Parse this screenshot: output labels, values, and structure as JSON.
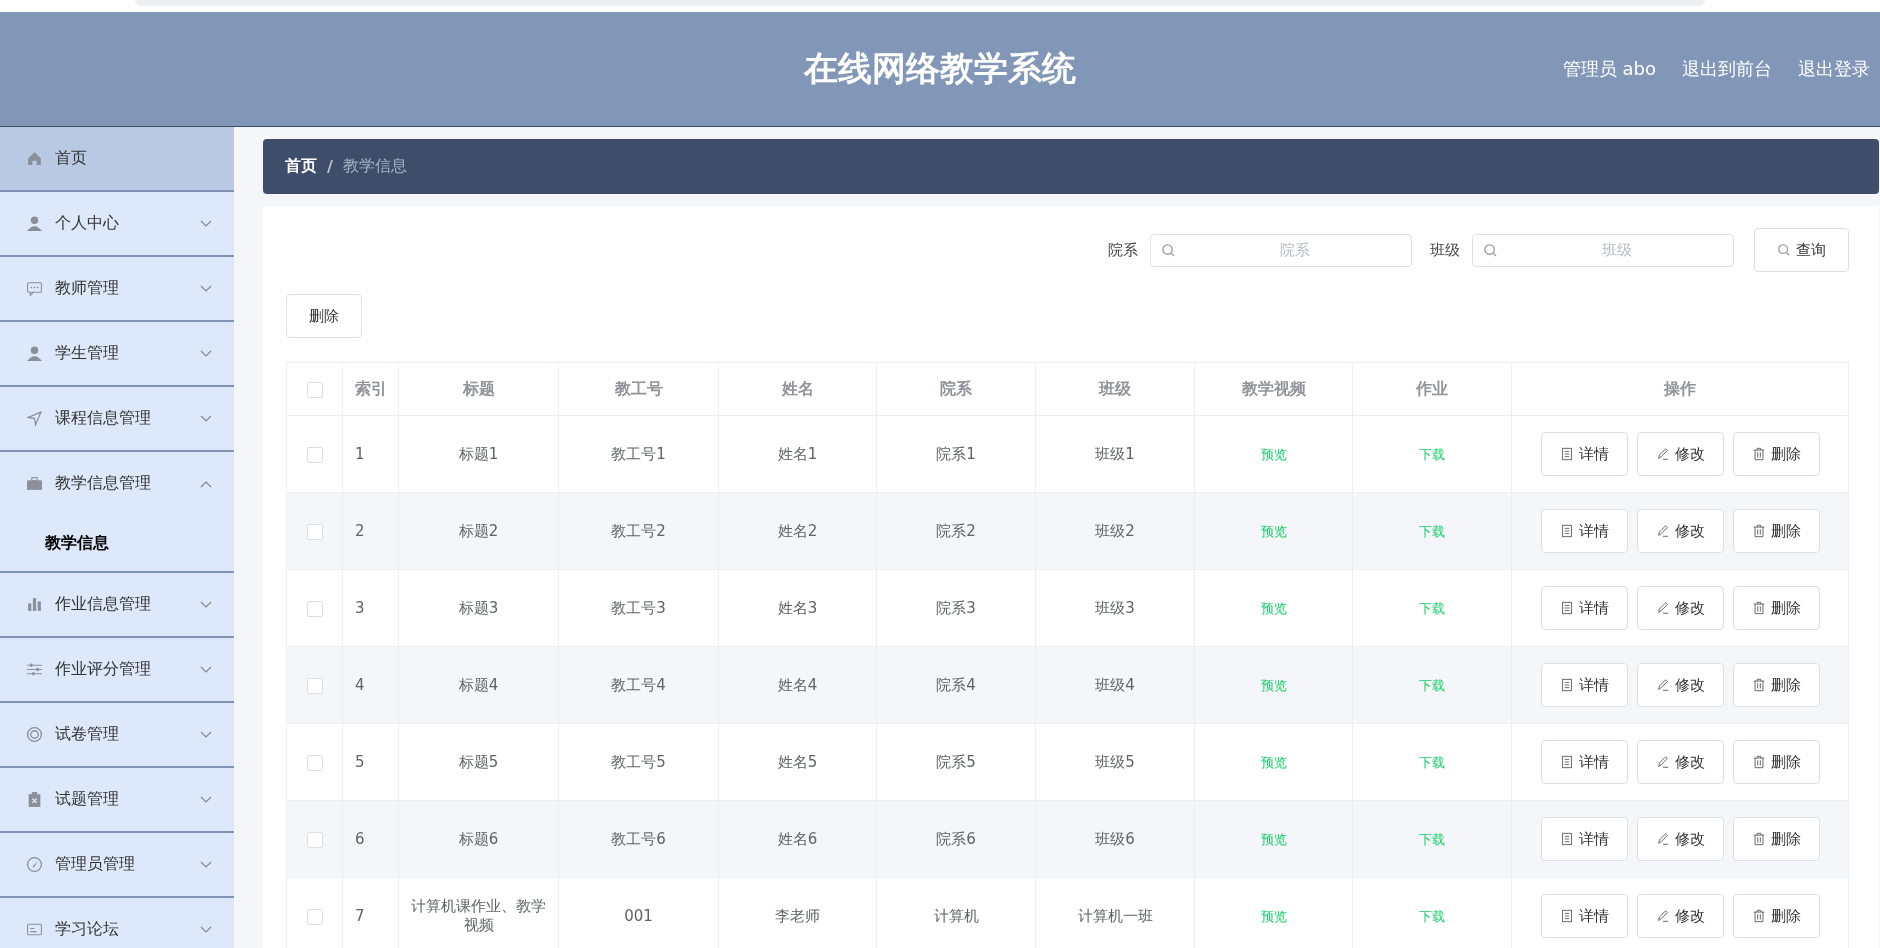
{
  "header": {
    "title": "在线网络教学系统",
    "links": [
      "管理员 abo",
      "退出到前台",
      "退出登录"
    ]
  },
  "sidebar": {
    "items": [
      {
        "label": "首页",
        "selected": true
      },
      {
        "label": "个人中心",
        "selected": false,
        "expanded": false
      },
      {
        "label": "教师管理",
        "selected": false,
        "expanded": false
      },
      {
        "label": "学生管理",
        "selected": false,
        "expanded": false
      },
      {
        "label": "课程信息管理",
        "selected": false,
        "expanded": false
      },
      {
        "label": "教学信息管理",
        "selected": false,
        "expanded": true,
        "children": [
          {
            "label": "教学信息",
            "selected": true
          }
        ]
      },
      {
        "label": "作业信息管理",
        "selected": false,
        "expanded": false
      },
      {
        "label": "作业评分管理",
        "selected": false,
        "expanded": false
      },
      {
        "label": "试卷管理",
        "selected": false,
        "expanded": false
      },
      {
        "label": "试题管理",
        "selected": false,
        "expanded": false
      },
      {
        "label": "管理员管理",
        "selected": false,
        "expanded": false
      },
      {
        "label": "学习论坛",
        "selected": false,
        "expanded": false
      }
    ]
  },
  "breadcrumb": {
    "items": [
      "首页",
      "教学信息"
    ],
    "separator": "/"
  },
  "search": {
    "fields": [
      {
        "label": "院系",
        "placeholder": "院系"
      },
      {
        "label": "班级",
        "placeholder": "班级"
      }
    ],
    "button": "查询"
  },
  "delete_button": "删除",
  "table": {
    "select_all_checked": false,
    "columns": [
      "索引",
      "标题",
      "教工号",
      "姓名",
      "院系",
      "班级",
      "教学视频",
      "作业",
      "操作"
    ],
    "rows": [
      {
        "checked": false,
        "cells": [
          "1",
          "标题1",
          "教工号1",
          "姓名1",
          "院系1",
          "班级1",
          "预览",
          "下载"
        ],
        "actions": [
          "详情",
          "修改",
          "删除"
        ]
      },
      {
        "checked": false,
        "cells": [
          "2",
          "标题2",
          "教工号2",
          "姓名2",
          "院系2",
          "班级2",
          "预览",
          "下载"
        ],
        "actions": [
          "详情",
          "修改",
          "删除"
        ]
      },
      {
        "checked": false,
        "cells": [
          "3",
          "标题3",
          "教工号3",
          "姓名3",
          "院系3",
          "班级3",
          "预览",
          "下载"
        ],
        "actions": [
          "详情",
          "修改",
          "删除"
        ]
      },
      {
        "checked": false,
        "cells": [
          "4",
          "标题4",
          "教工号4",
          "姓名4",
          "院系4",
          "班级4",
          "预览",
          "下载"
        ],
        "actions": [
          "详情",
          "修改",
          "删除"
        ]
      },
      {
        "checked": false,
        "cells": [
          "5",
          "标题5",
          "教工号5",
          "姓名5",
          "院系5",
          "班级5",
          "预览",
          "下载"
        ],
        "actions": [
          "详情",
          "修改",
          "删除"
        ]
      },
      {
        "checked": false,
        "cells": [
          "6",
          "标题6",
          "教工号6",
          "姓名6",
          "院系6",
          "班级6",
          "预览",
          "下载"
        ],
        "actions": [
          "详情",
          "修改",
          "删除"
        ]
      },
      {
        "checked": false,
        "cells": [
          "7",
          "计算机课作业、教学视频",
          "001",
          "李老师",
          "计算机",
          "计算机一班",
          "预览",
          "下载"
        ],
        "actions": [
          "详情",
          "修改",
          "删除"
        ]
      }
    ]
  }
}
